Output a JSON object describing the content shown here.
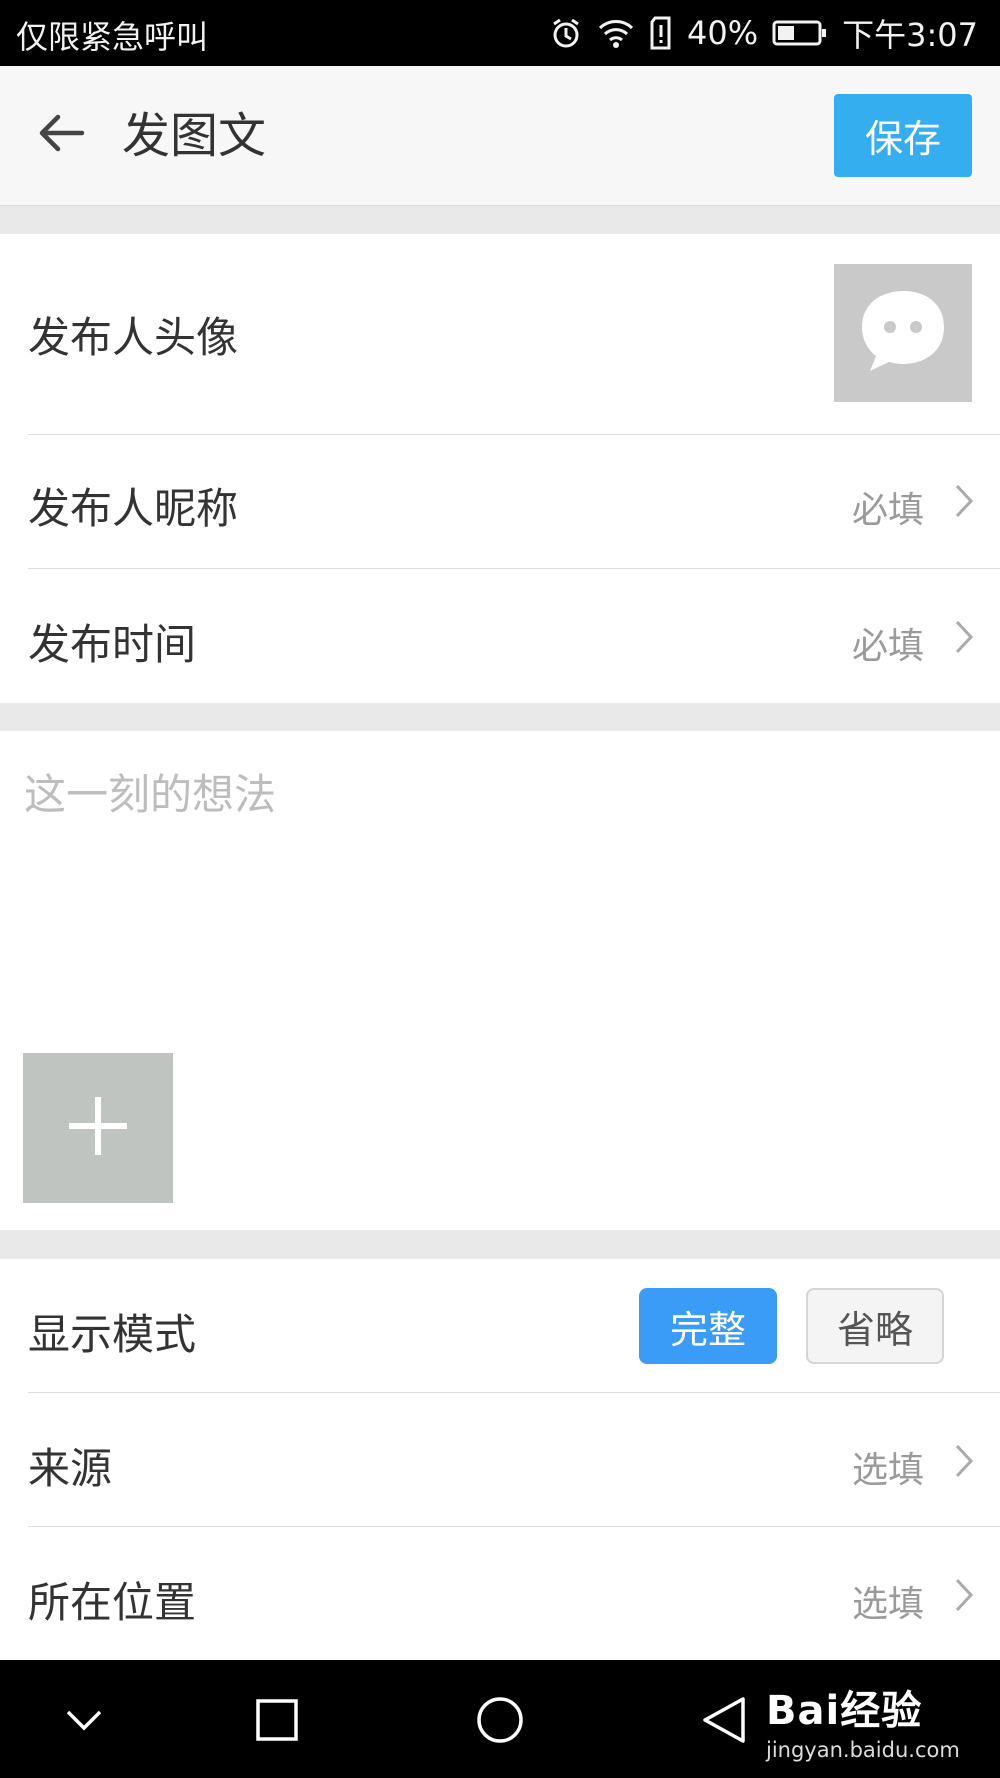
{
  "status_bar": {
    "carrier": "仅限紧急呼叫",
    "battery_percent": "40%",
    "time": "下午3:07",
    "icons": [
      "alarm-icon",
      "wifi-icon",
      "sim-alert-icon",
      "battery-icon"
    ]
  },
  "header": {
    "back_icon": "arrow-left-icon",
    "title": "发图文",
    "save_label": "保存"
  },
  "profile": {
    "avatar_label": "发布人头像",
    "avatar_icon": "chat-bubble-icon",
    "nickname_label": "发布人昵称",
    "nickname_hint": "必填",
    "time_label": "发布时间",
    "time_hint": "必填"
  },
  "compose": {
    "placeholder": "这一刻的想法",
    "add_icon": "plus-icon"
  },
  "settings": {
    "display_mode_label": "显示模式",
    "display_mode_options": [
      "完整",
      "省略"
    ],
    "display_mode_selected": "完整",
    "source_label": "来源",
    "source_hint": "选填",
    "location_label": "所在位置",
    "location_hint": "选填"
  },
  "nav_bar": {
    "icons": [
      "collapse-chevron-icon",
      "recents-square-icon",
      "home-circle-icon",
      "back-triangle-icon"
    ]
  },
  "watermark": {
    "brand": "Bai经验",
    "url": "jingyan.baidu.com"
  },
  "colors": {
    "primary": "#35aef0",
    "selected_mode": "#3b9cf8",
    "page_bg": "#e9e9e9"
  }
}
